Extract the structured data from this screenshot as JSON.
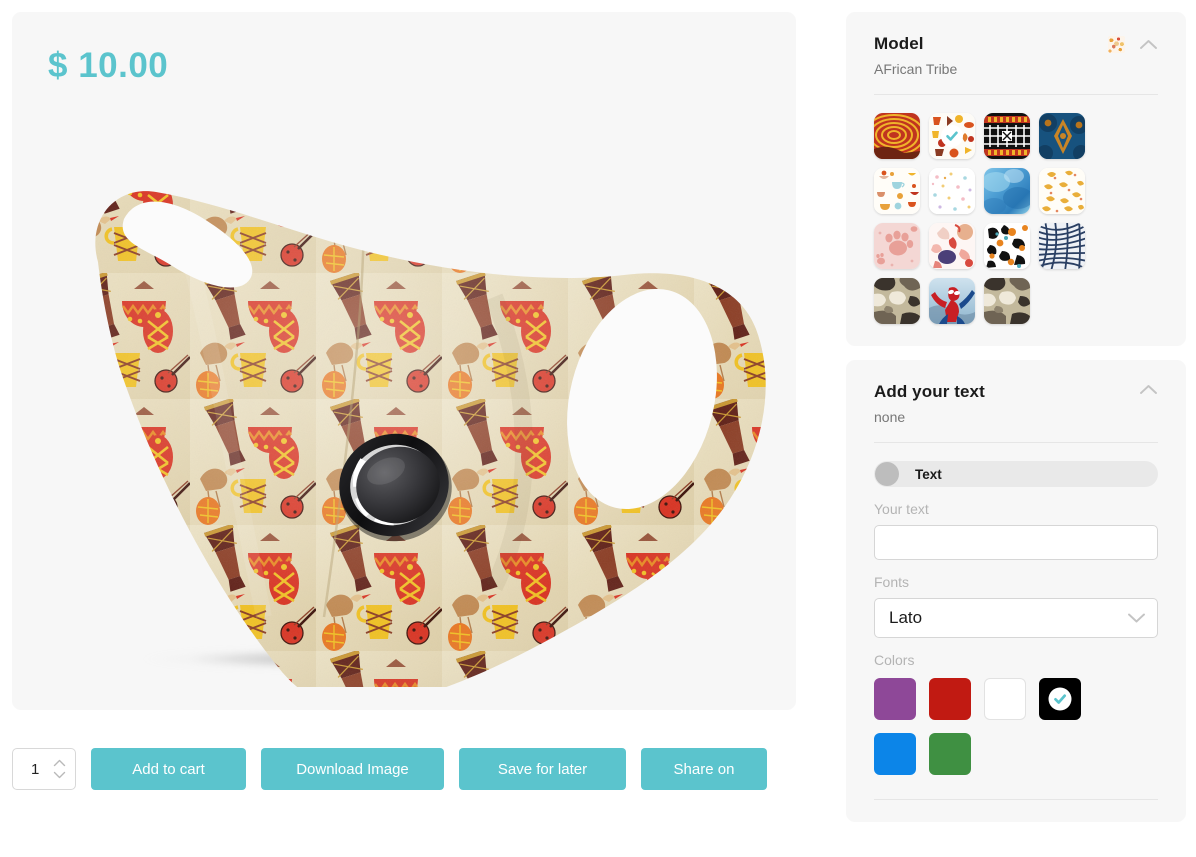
{
  "product": {
    "price": "$ 10.00",
    "price_color": "#5bc4cd",
    "image_alt": "African tribal pattern face mask with breathing valve"
  },
  "actions": {
    "quantity": "1",
    "quantity_up_icon": "chevron-up-icon",
    "quantity_down_icon": "chevron-down-icon",
    "add_to_cart": "Add to cart",
    "download_image": "Download Image",
    "save_for_later": "Save for later",
    "share_on": "Share on",
    "button_color": "#5bc4cd"
  },
  "model_panel": {
    "title": "Model",
    "subtitle": "AFrican Tribe",
    "preview_icon": "pattern-swatch-icon",
    "collapse_icon": "chevron-up-icon",
    "selected_index": 1,
    "thumbnails": [
      {
        "name": "red-spiral-weave",
        "label": "Red spiral weave"
      },
      {
        "name": "african-tribe",
        "label": "AFrican Tribe"
      },
      {
        "name": "kente-black-red",
        "label": "Kente black red"
      },
      {
        "name": "indigo-ankara",
        "label": "Indigo ankara"
      },
      {
        "name": "tea-cups-pattern",
        "label": "Tea cups"
      },
      {
        "name": "confetti-dots",
        "label": "Confetti dots"
      },
      {
        "name": "blue-watercolor",
        "label": "Blue watercolor"
      },
      {
        "name": "golden-leaves",
        "label": "Golden leaves"
      },
      {
        "name": "pink-paw-prints",
        "label": "Pink paw prints"
      },
      {
        "name": "coral-abstract",
        "label": "Coral abstract"
      },
      {
        "name": "black-orange-splatter",
        "label": "Black orange splatter"
      },
      {
        "name": "navy-optical-swirl",
        "label": "Navy optical swirl"
      },
      {
        "name": "brown-camouflage",
        "label": "Brown camouflage"
      },
      {
        "name": "spiderman",
        "label": "Spiderman"
      },
      {
        "name": "brown-camouflage-2",
        "label": "Brown camouflage"
      }
    ]
  },
  "text_panel": {
    "title": "Add your text",
    "subtitle": "none",
    "collapse_icon": "chevron-up-icon",
    "toggle_label": "Text",
    "toggle_on": false,
    "your_text_label": "Your text",
    "your_text_value": "",
    "your_text_placeholder": "",
    "fonts_label": "Fonts",
    "font_selected": "Lato",
    "font_options": [
      "Lato"
    ],
    "dropdown_icon": "chevron-down-icon",
    "colors_label": "Colors",
    "selected_color_index": 3,
    "colors": [
      {
        "name": "purple",
        "hex": "#8e4898"
      },
      {
        "name": "red",
        "hex": "#c11a12"
      },
      {
        "name": "white",
        "hex": "#ffffff"
      },
      {
        "name": "black",
        "hex": "#000000"
      },
      {
        "name": "blue",
        "hex": "#0c85e8"
      },
      {
        "name": "green",
        "hex": "#3f9042"
      }
    ],
    "check_icon": "check-icon",
    "check_color": "#5bc4cd"
  }
}
